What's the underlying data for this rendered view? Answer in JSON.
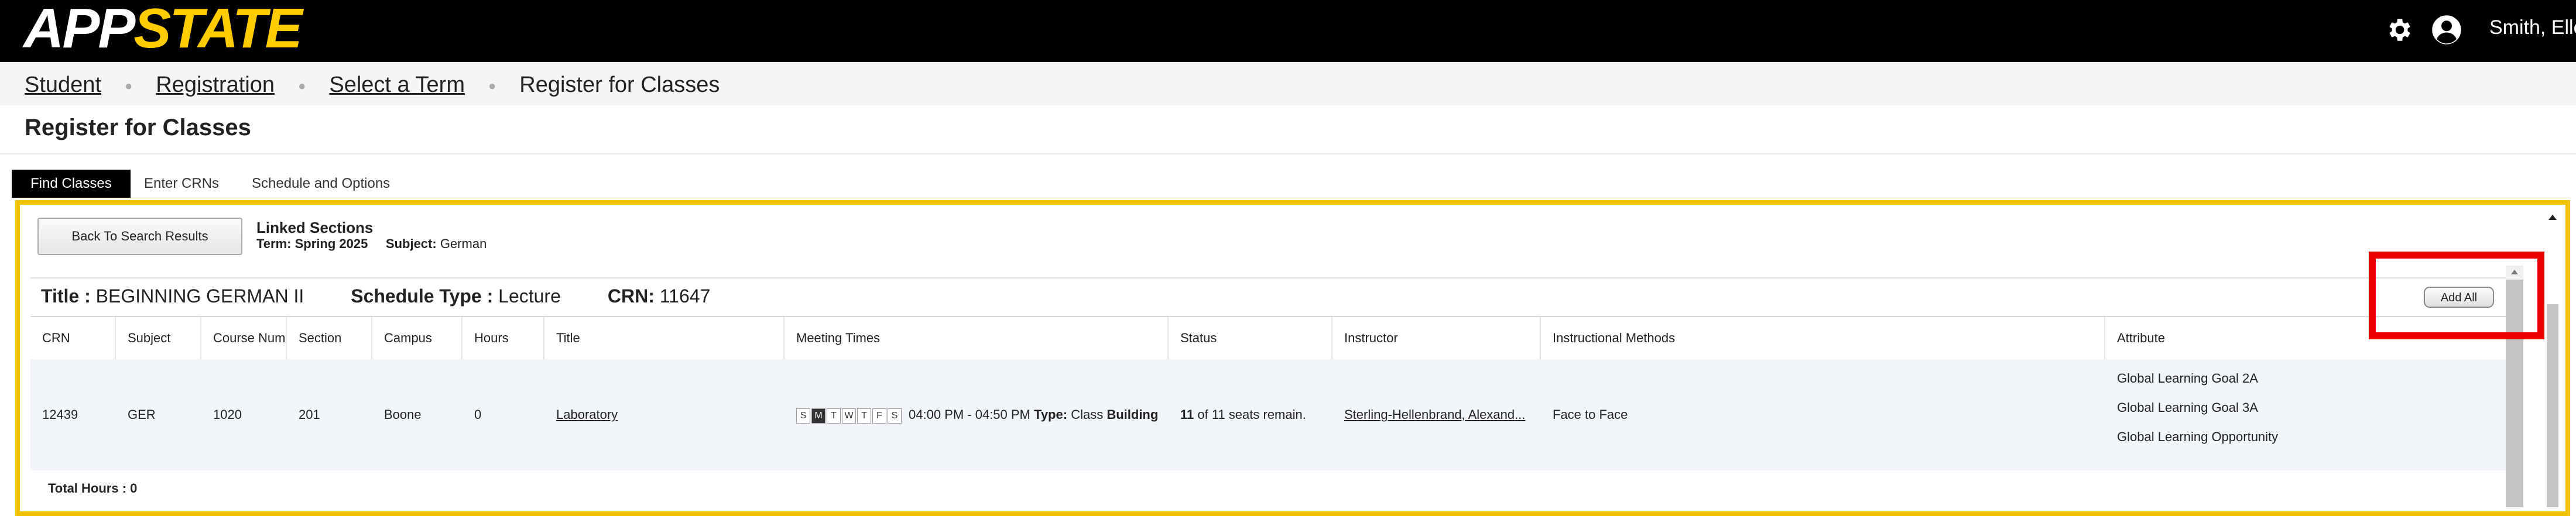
{
  "header": {
    "logo_app": "APP",
    "logo_state": "STATE",
    "user_name": "Smith, Elle",
    "settings_icon": "gear-icon",
    "user_icon": "user-circle-icon"
  },
  "breadcrumb": {
    "items": [
      "Student",
      "Registration",
      "Select a Term"
    ],
    "current": "Register for Classes"
  },
  "page": {
    "title": "Register for Classes"
  },
  "tabs": [
    {
      "label": "Find Classes",
      "active": true
    },
    {
      "label": "Enter CRNs",
      "active": false
    },
    {
      "label": "Schedule and Options",
      "active": false
    }
  ],
  "linked": {
    "back_label": "Back To Search Results",
    "heading": "Linked Sections",
    "term_label": "Term:",
    "term_value": "Spring 2025",
    "subject_label": "Subject:",
    "subject_value": "German"
  },
  "course": {
    "title_label": "Title :",
    "title_value": "BEGINNING GERMAN II",
    "schedule_label": "Schedule Type :",
    "schedule_value": "Lecture",
    "crn_label": "CRN:",
    "crn_value": "11647",
    "add_all_label": "Add All"
  },
  "table": {
    "headers": [
      "CRN",
      "Subject",
      "Course Numl",
      "Section",
      "Campus",
      "Hours",
      "Title",
      "Meeting Times",
      "Status",
      "Instructor",
      "Instructional Methods",
      "Attribute"
    ],
    "row": {
      "crn": "12439",
      "subject": "GER",
      "course_number": "1020",
      "section": "201",
      "campus": "Boone",
      "hours": "0",
      "title": "Laboratory",
      "days": [
        "S",
        "M",
        "T",
        "W",
        "T",
        "F",
        "S"
      ],
      "active_day_index": 1,
      "time": "04:00 PM - 04:50 PM",
      "type_label": "Type:",
      "type_value": "Class",
      "building_label": "Building",
      "status_count": "11",
      "status_text": "of 11 seats remain.",
      "instructor": "Sterling-Hellenbrand, Alexand...",
      "method": "Face to Face",
      "attributes": [
        "Global Learning Goal 2A",
        "Global Learning Goal 3A",
        "Global Learning Opportunity"
      ]
    },
    "total_label": "Total Hours : 0"
  },
  "colors": {
    "topbar": "#000000",
    "logo_accent": "#ffcc00",
    "panel_border": "#f2c200",
    "highlight": "#ee0000"
  }
}
